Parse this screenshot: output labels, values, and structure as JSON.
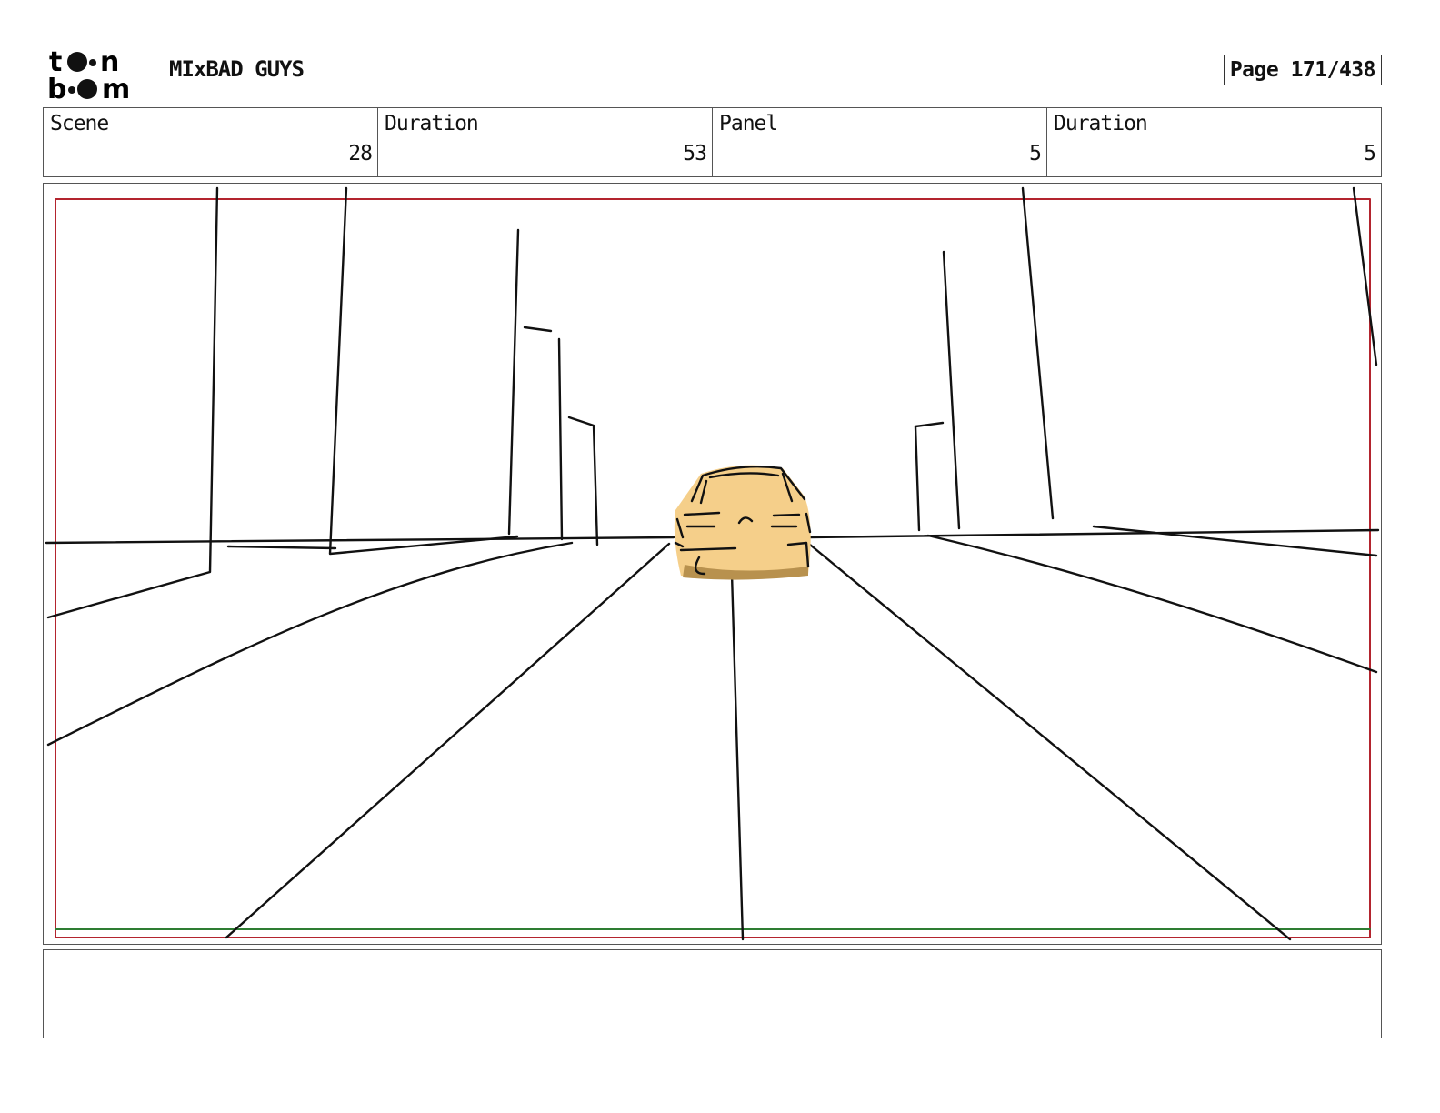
{
  "header": {
    "logo_text": "toon boom",
    "project_title": "MIxBAD GUYS",
    "page_label": "Page 171/438"
  },
  "info": {
    "scene_label": "Scene",
    "scene_value": "28",
    "scene_duration_label": "Duration",
    "scene_duration_value": "53",
    "panel_label": "Panel",
    "panel_value": "5",
    "panel_duration_label": "Duration",
    "panel_duration_value": "5"
  },
  "panel": {
    "safe_frame_color": "#b3242e",
    "guide_color": "#2e7d32",
    "car_color": "#f5cf8a",
    "car_shadow_color": "#b8914e"
  },
  "notes": {
    "text": ""
  }
}
